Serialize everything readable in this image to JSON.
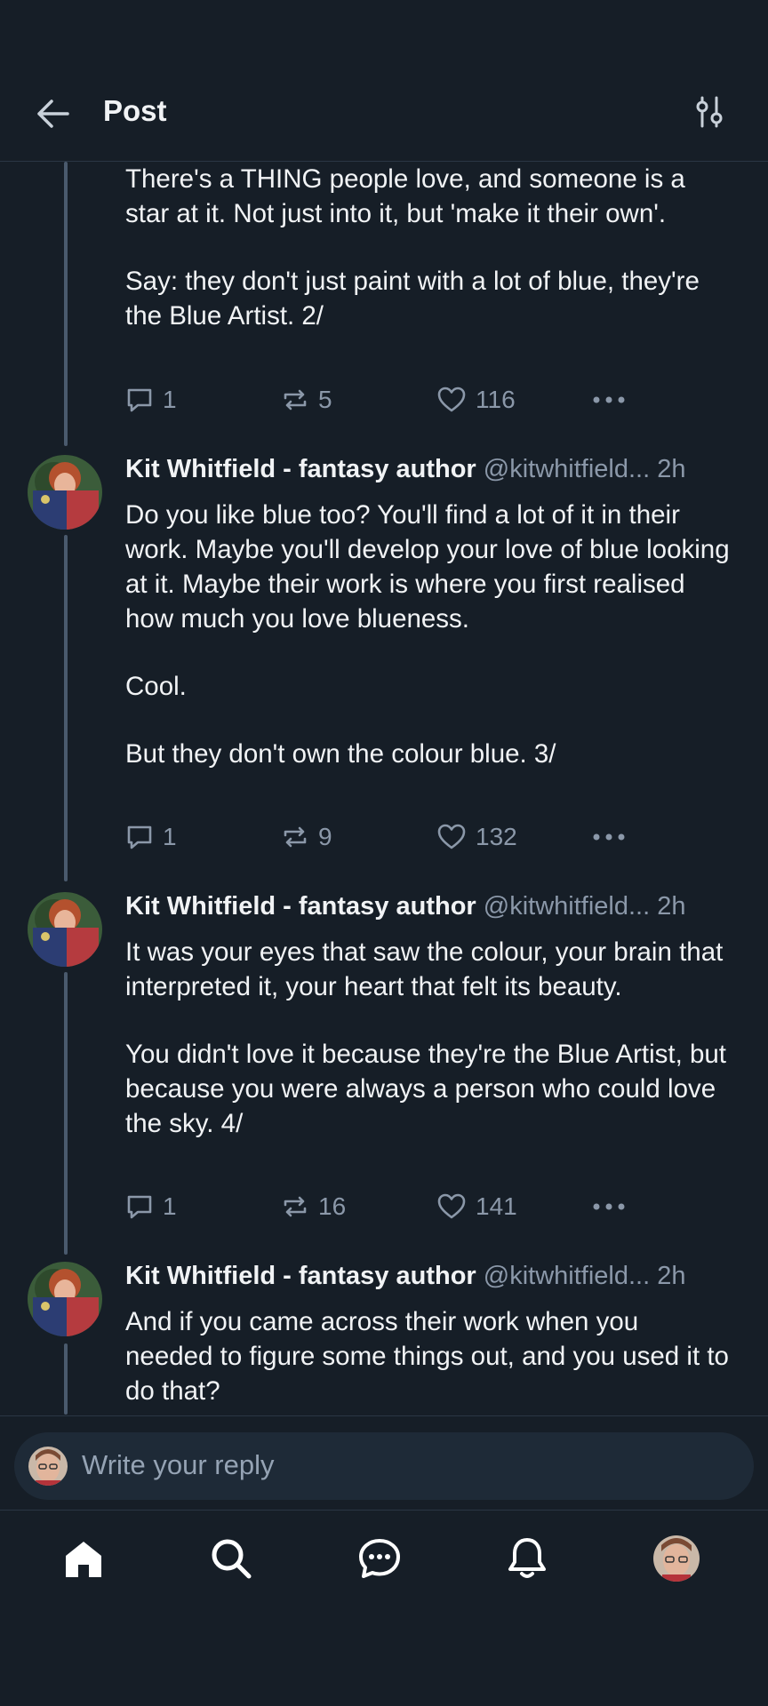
{
  "header": {
    "title": "Post",
    "back_icon": "arrow-left-icon",
    "filter_icon": "sliders-icon"
  },
  "posts": [
    {
      "author": "",
      "handle": "",
      "time": "",
      "paragraphs": [
        "There's a THING people love, and someone is a star at it. Not just into it, but 'make it their own'.",
        "Say: they don't just paint with a lot of blue, they're the Blue Artist. 2/"
      ],
      "replies": "1",
      "reposts": "5",
      "likes": "116"
    },
    {
      "author": "Kit Whitfield - fantasy author",
      "handle": "@kitwhitfield...",
      "time": "2h",
      "paragraphs": [
        "Do you like blue too? You'll find a lot of it in their work. Maybe you'll develop your love of blue looking at it. Maybe their work is where you first realised how much you love blueness.",
        "Cool.",
        "But they don't own the colour blue. 3/"
      ],
      "replies": "1",
      "reposts": "9",
      "likes": "132"
    },
    {
      "author": "Kit Whitfield - fantasy author",
      "handle": "@kitwhitfield...",
      "time": "2h",
      "paragraphs": [
        "It was your eyes that saw the colour, your brain that interpreted it, your heart that felt its beauty.",
        "You didn't love it because they're the Blue Artist, but because you were always a person who could love the sky. 4/"
      ],
      "replies": "1",
      "reposts": "16",
      "likes": "141"
    },
    {
      "author": "Kit Whitfield - fantasy author",
      "handle": "@kitwhitfield...",
      "time": "2h",
      "paragraphs": [
        "And if you came across their work when you needed to figure some things out, and you used it to do that?"
      ]
    }
  ],
  "composer": {
    "placeholder": "Write your reply"
  },
  "tabs": [
    "home-icon",
    "search-icon",
    "chat-icon",
    "bell-icon",
    "profile-avatar"
  ],
  "colors": {
    "background": "#161e27",
    "text": "#f1f3f5",
    "muted": "#8b98a9",
    "thread_line": "#4a5a6d",
    "input_bg": "#1e2a37"
  }
}
